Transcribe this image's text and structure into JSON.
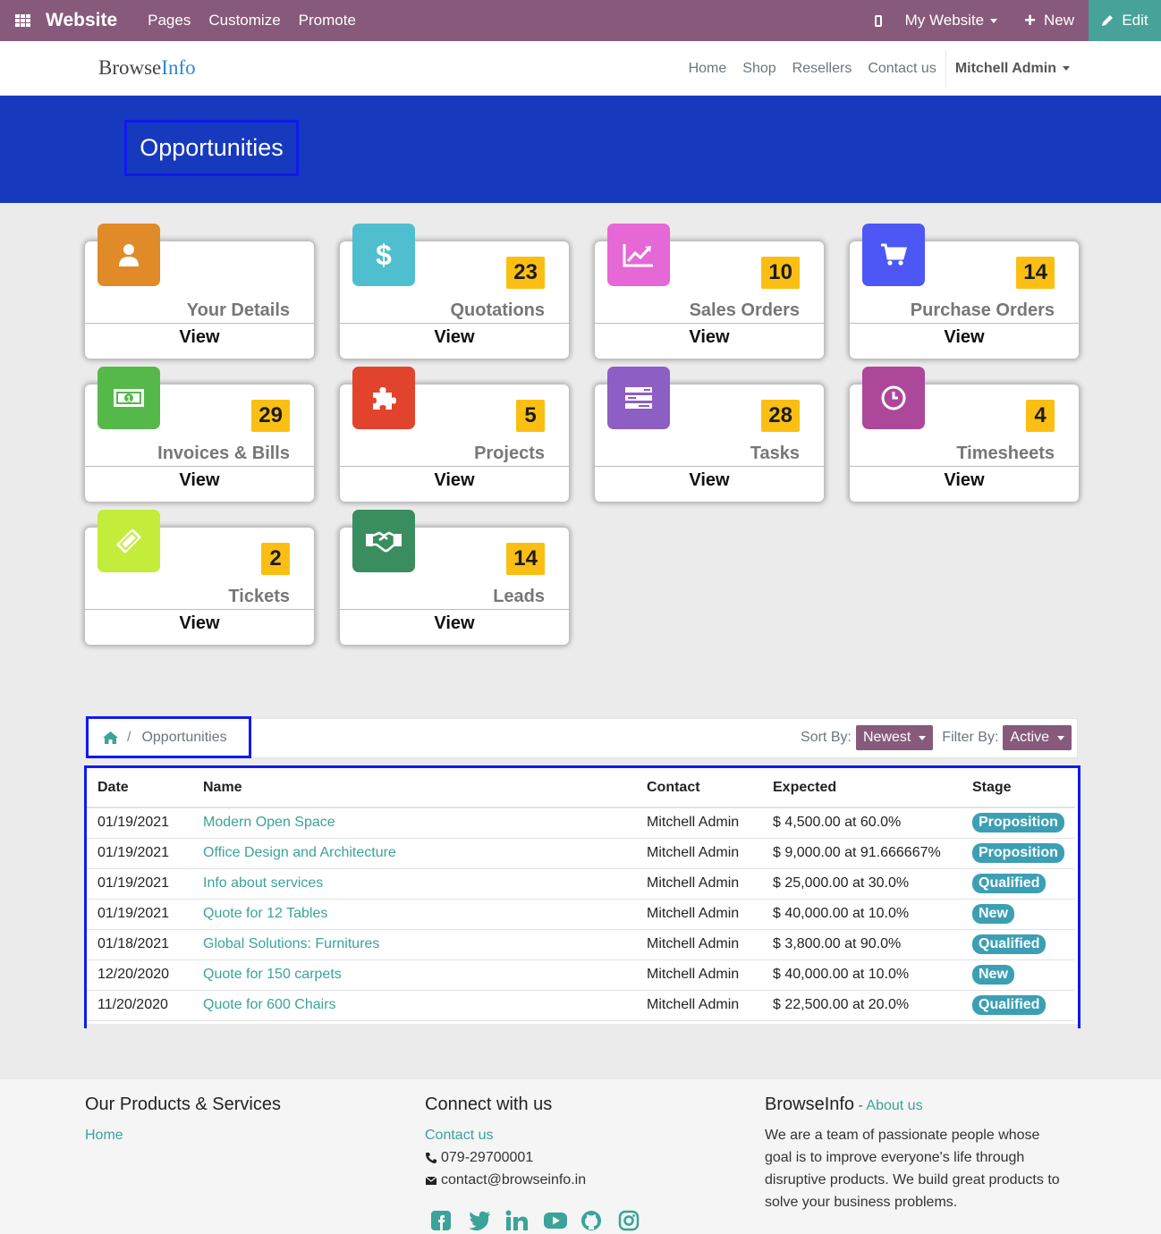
{
  "topbar": {
    "brand": "Website",
    "menu": [
      "Pages",
      "Customize",
      "Promote"
    ],
    "site_switcher": "My Website",
    "new_label": "New",
    "edit_label": "Edit",
    "color": "#875a7b"
  },
  "site_header": {
    "logo_part1": "Browse",
    "logo_part2": "Info",
    "nav": [
      "Home",
      "Shop",
      "Resellers",
      "Contact us"
    ],
    "user": "Mitchell Admin"
  },
  "banner": {
    "title": "Opportunities",
    "color": "#1739bd"
  },
  "cards": [
    {
      "label": "Your Details",
      "count": "",
      "icon": "user-icon",
      "color": "#e08a28",
      "view": "View"
    },
    {
      "label": "Quotations",
      "count": "23",
      "icon": "dollar-icon",
      "color": "#4fbfcf",
      "view": "View"
    },
    {
      "label": "Sales Orders",
      "count": "10",
      "icon": "chart-line-icon",
      "color": "#e667d6",
      "view": "View"
    },
    {
      "label": "Purchase Orders",
      "count": "14",
      "icon": "cart-icon",
      "color": "#4d57f5",
      "view": "View"
    },
    {
      "label": "Invoices & Bills",
      "count": "29",
      "icon": "money-bill-icon",
      "color": "#55b94a",
      "view": "View"
    },
    {
      "label": "Projects",
      "count": "5",
      "icon": "puzzle-icon",
      "color": "#e2432c",
      "view": "View"
    },
    {
      "label": "Tasks",
      "count": "28",
      "icon": "tasks-icon",
      "color": "#8d5ec4",
      "view": "View"
    },
    {
      "label": "Timesheets",
      "count": "4",
      "icon": "clock-icon",
      "color": "#ad4799",
      "view": "View"
    },
    {
      "label": "Tickets",
      "count": "2",
      "icon": "ticket-icon",
      "color": "#c3ec3b",
      "view": "View"
    },
    {
      "label": "Leads",
      "count": "14",
      "icon": "handshake-icon",
      "color": "#3a8d5e",
      "view": "View"
    }
  ],
  "breadcrumb": {
    "current": "Opportunities"
  },
  "sort": {
    "label": "Sort By:",
    "value": "Newest"
  },
  "filter": {
    "label": "Filter By:",
    "value": "Active"
  },
  "table": {
    "headers": [
      "Date",
      "Name",
      "Contact",
      "Expected",
      "Stage"
    ],
    "rows": [
      {
        "date": "01/19/2021",
        "name": "Modern Open Space",
        "contact": "Mitchell Admin",
        "expected": "$ 4,500.00 at 60.0%",
        "stage": "Proposition"
      },
      {
        "date": "01/19/2021",
        "name": "Office Design and Architecture",
        "contact": "Mitchell Admin",
        "expected": "$ 9,000.00 at 91.666667%",
        "stage": "Proposition"
      },
      {
        "date": "01/19/2021",
        "name": "Info about services",
        "contact": "Mitchell Admin",
        "expected": "$ 25,000.00 at 30.0%",
        "stage": "Qualified"
      },
      {
        "date": "01/19/2021",
        "name": "Quote for 12 Tables",
        "contact": "Mitchell Admin",
        "expected": "$ 40,000.00 at 10.0%",
        "stage": "New"
      },
      {
        "date": "01/18/2021",
        "name": "Global Solutions: Furnitures",
        "contact": "Mitchell Admin",
        "expected": "$ 3,800.00 at 90.0%",
        "stage": "Qualified"
      },
      {
        "date": "12/20/2020",
        "name": "Quote for 150 carpets",
        "contact": "Mitchell Admin",
        "expected": "$ 40,000.00 at 10.0%",
        "stage": "New"
      },
      {
        "date": "11/20/2020",
        "name": "Quote for 600 Chairs",
        "contact": "Mitchell Admin",
        "expected": "$ 22,500.00 at 20.0%",
        "stage": "Qualified"
      }
    ]
  },
  "footer": {
    "products_title": "Our Products & Services",
    "products_links": [
      "Home"
    ],
    "connect_title": "Connect with us",
    "contact_link": "Contact us",
    "phone": "079-29700001",
    "email": "contact@browseinfo.in",
    "about_title": "BrowseInfo",
    "about_sep": " - ",
    "about_link": "About us",
    "about_text": "We are a team of passionate people whose goal is to improve everyone's life through disruptive products. We build great products to solve your business problems.",
    "social_icons": [
      "facebook-icon",
      "twitter-icon",
      "linkedin-icon",
      "youtube-icon",
      "github-icon",
      "instagram-icon"
    ],
    "link_color": "#3aa39a"
  }
}
